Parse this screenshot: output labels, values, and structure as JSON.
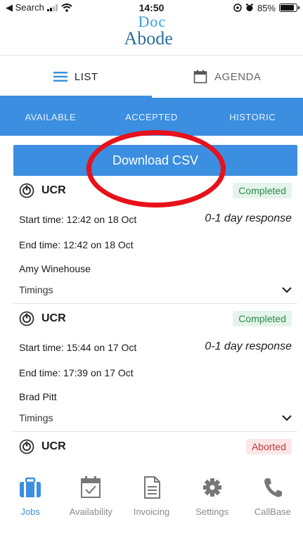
{
  "status_bar": {
    "back_label": "◀ Search",
    "time": "14:50",
    "battery": "85%",
    "battery_level": 0.85
  },
  "logo": {
    "top": "Doc",
    "bottom": "Abode"
  },
  "view_tabs": [
    {
      "label": "LIST",
      "icon": "list-icon",
      "active": true
    },
    {
      "label": "AGENDA",
      "icon": "calendar-icon",
      "active": false
    }
  ],
  "filter_tabs": [
    {
      "label": "AVAILABLE"
    },
    {
      "label": "ACCEPTED"
    },
    {
      "label": "HISTORIC"
    }
  ],
  "download_label": "Download CSV",
  "jobs": [
    {
      "title": "UCR",
      "status": "Completed",
      "start": "Start time: 12:42 on 18 Oct",
      "response": "0-1 day response",
      "end": "End time: 12:42 on 18 Oct",
      "person": "Amy Winehouse",
      "timings_label": "Timings"
    },
    {
      "title": "UCR",
      "status": "Completed",
      "start": "Start time: 15:44 on 17 Oct",
      "response": "0-1 day response",
      "end": "End time: 17:39 on 17 Oct",
      "person": "Brad Pitt",
      "timings_label": "Timings"
    },
    {
      "title": "UCR",
      "status": "Aborted"
    }
  ],
  "bottom_nav": [
    {
      "label": "Jobs",
      "icon": "briefcase-icon",
      "active": true
    },
    {
      "label": "Availability",
      "icon": "calendar-check-icon",
      "active": false
    },
    {
      "label": "Invoicing",
      "icon": "document-icon",
      "active": false
    },
    {
      "label": "Settings",
      "icon": "gear-icon",
      "active": false
    },
    {
      "label": "CallBase",
      "icon": "phone-icon",
      "active": false
    }
  ],
  "colors": {
    "accent": "#3b8ee0",
    "highlight_ring": "#e8101a",
    "completed": "#2c8a4a",
    "aborted": "#c0393b"
  }
}
